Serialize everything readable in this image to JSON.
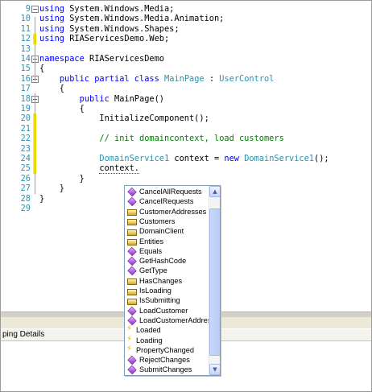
{
  "editor": {
    "lines": [
      {
        "num": "9",
        "tokens": [
          {
            "t": "using",
            "c": "kw"
          },
          {
            "t": " System.Windows.Media;",
            "c": ""
          }
        ]
      },
      {
        "num": "10",
        "tokens": [
          {
            "t": "using",
            "c": "kw"
          },
          {
            "t": " System.Windows.Media.Animation;",
            "c": ""
          }
        ]
      },
      {
        "num": "11",
        "tokens": [
          {
            "t": "using",
            "c": "kw"
          },
          {
            "t": " System.Windows.Shapes;",
            "c": ""
          }
        ]
      },
      {
        "num": "12",
        "tokens": [
          {
            "t": "using",
            "c": "kw"
          },
          {
            "t": " RIAServicesDemo.Web;",
            "c": ""
          }
        ]
      },
      {
        "num": "13",
        "tokens": []
      },
      {
        "num": "14",
        "tokens": [
          {
            "t": "namespace",
            "c": "kw"
          },
          {
            "t": " RIAServicesDemo",
            "c": ""
          }
        ]
      },
      {
        "num": "15",
        "tokens": [
          {
            "t": "{",
            "c": ""
          }
        ]
      },
      {
        "num": "16",
        "tokens": [
          {
            "t": "    ",
            "c": ""
          },
          {
            "t": "public partial class",
            "c": "kw"
          },
          {
            "t": " ",
            "c": ""
          },
          {
            "t": "MainPage",
            "c": "ty"
          },
          {
            "t": " : ",
            "c": ""
          },
          {
            "t": "UserControl",
            "c": "ty"
          }
        ]
      },
      {
        "num": "17",
        "tokens": [
          {
            "t": "    {",
            "c": ""
          }
        ]
      },
      {
        "num": "18",
        "tokens": [
          {
            "t": "        ",
            "c": ""
          },
          {
            "t": "public",
            "c": "kw"
          },
          {
            "t": " MainPage()",
            "c": ""
          }
        ]
      },
      {
        "num": "19",
        "tokens": [
          {
            "t": "        {",
            "c": ""
          }
        ]
      },
      {
        "num": "20",
        "tokens": [
          {
            "t": "            InitializeComponent();",
            "c": ""
          }
        ]
      },
      {
        "num": "21",
        "tokens": []
      },
      {
        "num": "22",
        "tokens": [
          {
            "t": "            ",
            "c": ""
          },
          {
            "t": "// init domaincontext, load customers",
            "c": "cm"
          }
        ]
      },
      {
        "num": "23",
        "tokens": []
      },
      {
        "num": "24",
        "tokens": [
          {
            "t": "            ",
            "c": ""
          },
          {
            "t": "DomainService1",
            "c": "ty"
          },
          {
            "t": " context = ",
            "c": ""
          },
          {
            "t": "new",
            "c": "kw"
          },
          {
            "t": " ",
            "c": ""
          },
          {
            "t": "DomainService1",
            "c": "ty"
          },
          {
            "t": "();",
            "c": ""
          }
        ]
      },
      {
        "num": "25",
        "tokens": [
          {
            "t": "            ",
            "c": ""
          },
          {
            "t": "context.",
            "c": "squig"
          }
        ]
      },
      {
        "num": "26",
        "tokens": [
          {
            "t": "        }",
            "c": ""
          }
        ]
      },
      {
        "num": "27",
        "tokens": [
          {
            "t": "    }",
            "c": ""
          }
        ]
      },
      {
        "num": "28",
        "tokens": [
          {
            "t": "}",
            "c": ""
          }
        ]
      },
      {
        "num": "29",
        "tokens": []
      }
    ]
  },
  "intellisense": {
    "items": [
      {
        "label": "CancelAllRequests",
        "icon": "method-icon"
      },
      {
        "label": "CancelRequests",
        "icon": "method-icon"
      },
      {
        "label": "CustomerAddresses",
        "icon": "property-icon"
      },
      {
        "label": "Customers",
        "icon": "property-icon"
      },
      {
        "label": "DomainClient",
        "icon": "property-icon"
      },
      {
        "label": "Entities",
        "icon": "property-icon"
      },
      {
        "label": "Equals",
        "icon": "method-icon"
      },
      {
        "label": "GetHashCode",
        "icon": "method-icon"
      },
      {
        "label": "GetType",
        "icon": "method-icon"
      },
      {
        "label": "HasChanges",
        "icon": "property-icon"
      },
      {
        "label": "IsLoading",
        "icon": "property-icon"
      },
      {
        "label": "IsSubmitting",
        "icon": "property-icon"
      },
      {
        "label": "LoadCustomer",
        "icon": "method-icon"
      },
      {
        "label": "LoadCustomerAddress",
        "icon": "method-icon"
      },
      {
        "label": "Loaded",
        "icon": "event-icon"
      },
      {
        "label": "Loading",
        "icon": "event-icon"
      },
      {
        "label": "PropertyChanged",
        "icon": "event-icon"
      },
      {
        "label": "RejectChanges",
        "icon": "method-icon"
      },
      {
        "label": "SubmitChanges",
        "icon": "method-icon"
      }
    ]
  },
  "bottom_panel": {
    "tab_label": "ping Details"
  },
  "colors": {
    "keyword": "#0000ff",
    "type": "#2b91af",
    "comment": "#008000",
    "line_number": "#2b91af",
    "changed_line_marker": "#ffef00"
  }
}
